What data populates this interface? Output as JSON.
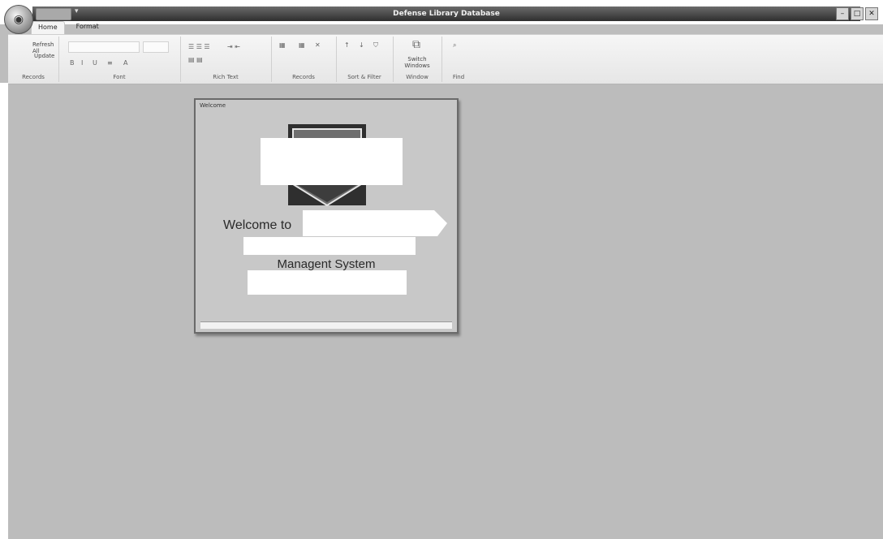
{
  "window": {
    "title": "Defense Library Database",
    "controls": [
      "minimize-icon",
      "maximize-icon",
      "close-icon"
    ]
  },
  "tabs": [
    {
      "label": "Home",
      "active": true
    },
    {
      "label": "Format",
      "active": false
    }
  ],
  "ribbon": {
    "groups": [
      {
        "label": "Records"
      },
      {
        "label": "Font"
      },
      {
        "label": "Rich Text"
      },
      {
        "label": "Records"
      },
      {
        "label": "Sort & Filter"
      },
      {
        "label": "Window"
      },
      {
        "label": "Find"
      }
    ],
    "refresh": "Refresh All",
    "update": "Update",
    "switch_windows": "Switch Windows"
  },
  "form": {
    "caption": "Welcome",
    "welcome_prefix": "Welcome to",
    "management_line": "Managent System"
  },
  "colors": {
    "workspace": "#bcbcbc",
    "titlebar": "#3a3a3a",
    "redaction": "#ffffff"
  }
}
